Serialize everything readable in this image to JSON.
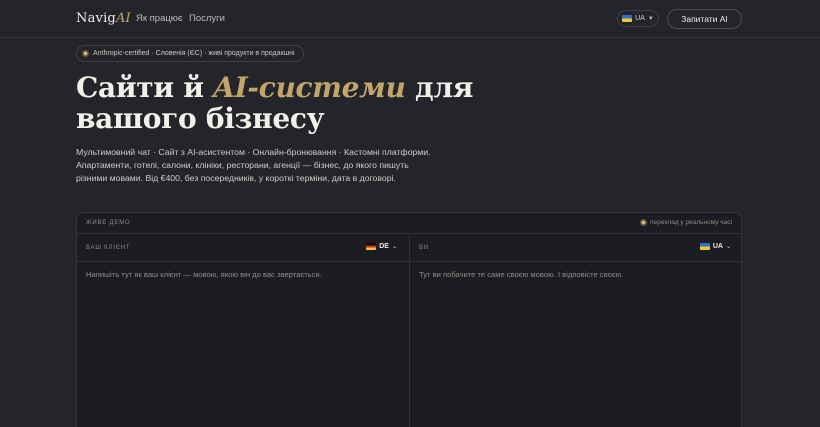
{
  "header": {
    "logo_main": "Navig",
    "logo_ai": "AI",
    "nav": [
      {
        "label": "Як працює"
      },
      {
        "label": "Послуги"
      }
    ],
    "lang": {
      "code": "UA",
      "flag": "ua-flag"
    },
    "ask_button": "Запитати AI"
  },
  "badge": {
    "text": "Anthropic-certified · Словенія (ЄС) · живі продукти в продакшні"
  },
  "hero": {
    "title_part1": "Сайти й ",
    "title_accent": "AI-системи",
    "title_part2": " для вашого бізнесу",
    "description": "Мультимовний чат · Сайт з AI-асистентом · Онлайн-бронювання · Кастомні платформи. Апартаменти, готелі, салони, клініки, ресторани, агенції — бізнес, до якого пишуть різними мовами. Від €400, без посередників, у короткі терміни, дата в договорі."
  },
  "demo": {
    "label": "ЖИВЕ ДЕМО",
    "live_text": "переклад у реальному часі",
    "client": {
      "label": "ВАШ КЛІЄНТ",
      "lang": "DE",
      "placeholder": "Напишіть тут як ваш клієнт — мовою, якою він до вас звертається."
    },
    "you": {
      "label": "ВИ",
      "lang": "UA",
      "placeholder": "Тут ви побачите те саме своєю мовою. І відповісте своєю."
    }
  },
  "colors": {
    "background": "#24252b",
    "panel": "#1c1d22",
    "accent": "#c2a56b",
    "text": "#e9e7e2"
  }
}
